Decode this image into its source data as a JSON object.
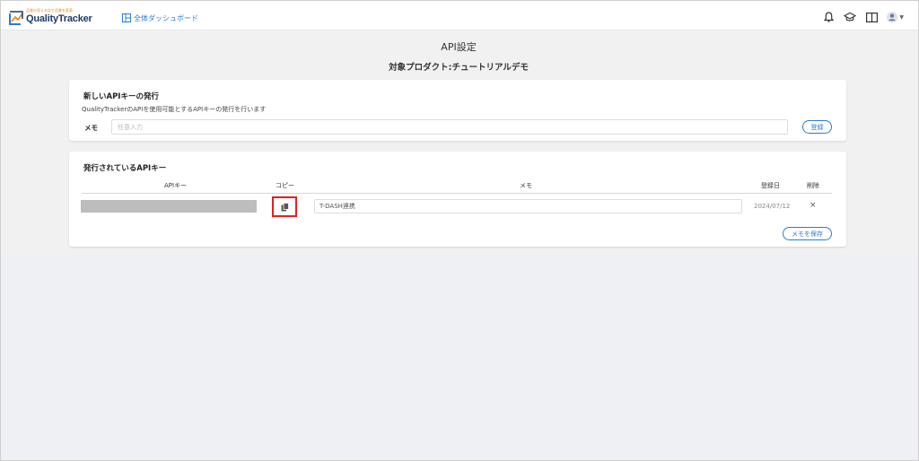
{
  "header": {
    "logo_tagline": "品質の見える化で品質を変革",
    "logo_name": "QualityTracker",
    "dashboard_link": "全体ダッシュボード",
    "icons": [
      "bell-icon",
      "graduation-cap-icon",
      "book-icon",
      "user-avatar-icon",
      "chevron-down-icon"
    ]
  },
  "page": {
    "title": "API設定",
    "subtitle": "対象プロダクト:チュートリアルデモ"
  },
  "new_key_card": {
    "title": "新しいAPIキーの発行",
    "description": "QualityTrackerのAPIを使用可能とするAPIキーの発行を行います",
    "memo_label": "メモ",
    "memo_placeholder": "任意入力",
    "register_button": "登録"
  },
  "issued_keys_card": {
    "title": "発行されているAPIキー",
    "columns": {
      "api_key": "APIキー",
      "copy": "コピー",
      "memo": "メモ",
      "registered_date": "登録日",
      "delete": "削除"
    },
    "rows": [
      {
        "memo": "T-DASH連携",
        "registered_date": "2024/07/12",
        "delete_symbol": "×"
      }
    ],
    "save_memo_button": "メモを保存"
  },
  "colors": {
    "accent": "#2b7bd0",
    "highlight": "#e02020",
    "logo_accent": "#e38a1c",
    "logo_text": "#1d3a6e"
  }
}
